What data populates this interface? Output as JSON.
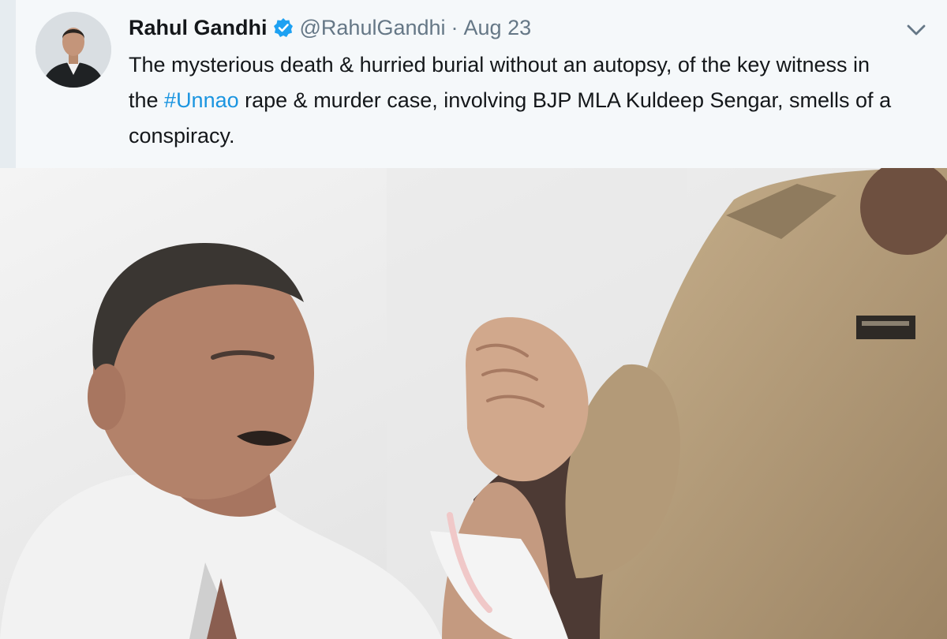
{
  "tweet": {
    "author_name": "Rahul Gandhi",
    "handle": "@RahulGandhi",
    "separator": "·",
    "timestamp": "Aug 23",
    "text_line1": "The mysterious death & hurried burial without an autopsy, of the key witness in",
    "text_line2_before": "the ",
    "hashtag": "#Unnao",
    "text_line2_after": " rape & murder case, involving BJP MLA Kuldeep Sengar, smells of a",
    "text_line3": "conspiracy.",
    "verified_icon": "verified-badge",
    "menu_icon": "chevron-down"
  },
  "colors": {
    "background": "#f5f8fa",
    "text": "#14171a",
    "secondary_text": "#657786",
    "link": "#1b95e0",
    "verified": "#1da1f2"
  }
}
